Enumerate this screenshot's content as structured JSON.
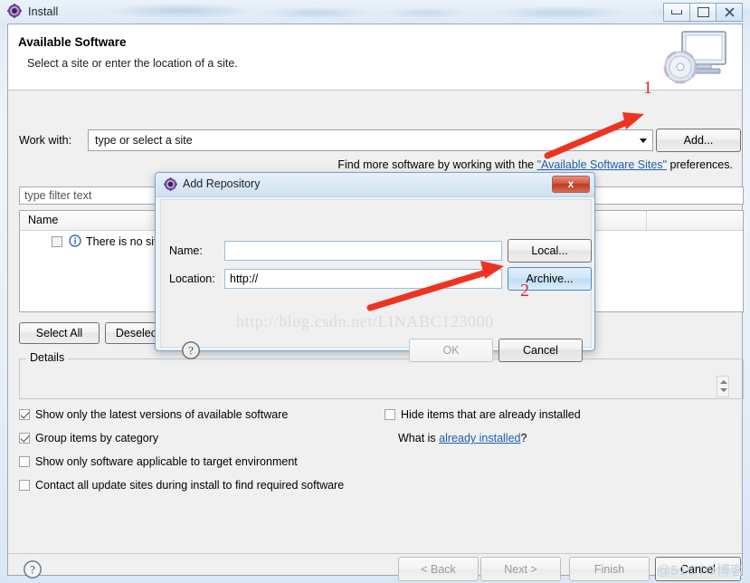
{
  "window": {
    "title": "Install",
    "icon": "eclipse-gear-icon",
    "controls": {
      "minimize": "minimize-icon",
      "maximize": "maximize-icon",
      "close": "close-icon"
    }
  },
  "header": {
    "title": "Available Software",
    "subtitle": "Select a site or enter the location of a site.",
    "icon": "install-monitor-cd-icon"
  },
  "workwith": {
    "label": "Work with:",
    "value": "type or select a site",
    "placeholder": "type or select a site",
    "add_label": "Add..."
  },
  "findmore": {
    "prefix": "Find more software by working with the ",
    "link": "\"Available Software Sites\"",
    "suffix": " preferences."
  },
  "filter": {
    "placeholder": "type filter text",
    "value": ""
  },
  "table": {
    "columns": [
      "Name",
      "",
      ""
    ],
    "rows": [
      {
        "checked": false,
        "icon": "info-icon",
        "label": "There is no site"
      }
    ]
  },
  "selection_buttons": {
    "select_all": "Select All",
    "deselect_all": "Deselect All"
  },
  "details": {
    "legend": "Details",
    "value": ""
  },
  "options": {
    "left": [
      {
        "label": "Show only the latest versions of available software",
        "checked": true
      },
      {
        "label": "Group items by category",
        "checked": true
      },
      {
        "label": "Show only software applicable to target environment",
        "checked": false
      },
      {
        "label": "Contact all update sites during install to find required software",
        "checked": false
      }
    ],
    "right": [
      {
        "label": "Hide items that are already installed",
        "checked": false
      }
    ],
    "whatis": {
      "prefix": "What is ",
      "link": "already installed",
      "suffix": "?"
    }
  },
  "footer": {
    "help": "help-icon",
    "back": "< Back",
    "next": "Next >",
    "finish": "Finish",
    "cancel": "Cancel"
  },
  "modal": {
    "title": "Add Repository",
    "icon": "eclipse-gear-icon",
    "close": "x",
    "name_label": "Name:",
    "name_value": "",
    "location_label": "Location:",
    "location_value": "http://",
    "local_label": "Local...",
    "archive_label": "Archive...",
    "help": "help-icon",
    "ok_label": "OK",
    "cancel_label": "Cancel",
    "watermark": "http://blog.csdn.net/LINABC123000"
  },
  "annotations": {
    "step1": "1",
    "step2": "2",
    "accent_color": "#ee2222"
  },
  "bottom_watermark": "@51CTO博客"
}
